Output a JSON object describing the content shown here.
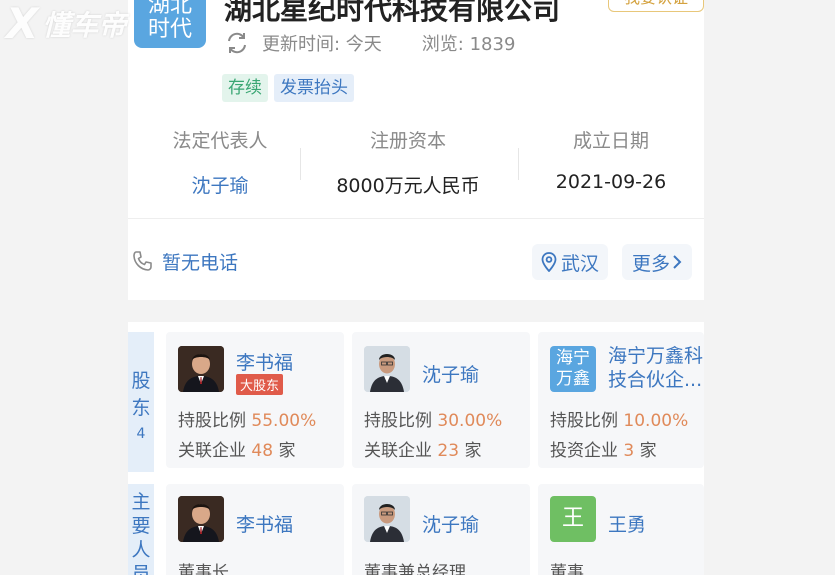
{
  "watermark": {
    "brand": "X",
    "text": "懂车帝"
  },
  "company": {
    "logo_text": [
      "湖北",
      "时代"
    ],
    "name": "湖北星纪时代科技有限公司",
    "claim_label": "我要认证",
    "updated": "更新时间: 今天",
    "views": "浏览: 1839",
    "tags": [
      "存续",
      "发票抬头"
    ]
  },
  "info": {
    "legal_rep_label": "法定代表人",
    "legal_rep_value": "沈子瑜",
    "capital_label": "注册资本",
    "capital_value": "8000万元人民币",
    "founded_label": "成立日期",
    "founded_value": "2021-09-26"
  },
  "contact": {
    "phone": "暂无电话",
    "city": "武汉",
    "more": "更多"
  },
  "shareholders": {
    "tab_label": [
      "股",
      "东"
    ],
    "count": "4",
    "items": [
      {
        "name": "李书福",
        "badge": "大股东",
        "ratio_label": "持股比例 ",
        "ratio": "55.00%",
        "rel_label": "关联企业 ",
        "rel_count": "48",
        "rel_unit": " 家"
      },
      {
        "name": "沈子瑜",
        "ratio_label": "持股比例 ",
        "ratio": "30.00%",
        "rel_label": "关联企业 ",
        "rel_count": "23",
        "rel_unit": " 家"
      },
      {
        "name_line1": "海宁万鑫科",
        "name_line2": "技合伙企...",
        "avatar_text": [
          "海宁",
          "万鑫"
        ],
        "ratio_label": "持股比例 ",
        "ratio": "10.00%",
        "rel_label": "投资企业 ",
        "rel_count": "3",
        "rel_unit": " 家"
      }
    ]
  },
  "staff": {
    "tab_label": [
      "主",
      "要",
      "人",
      "员"
    ],
    "items": [
      {
        "name": "李书福",
        "role": "董事长"
      },
      {
        "name": "沈子瑜",
        "role": "董事兼总经理"
      },
      {
        "name": "王勇",
        "avatar_text": "王",
        "role": "董事"
      }
    ]
  },
  "colors": {
    "link": "#3d77c0",
    "accent_orange": "#e08a5a",
    "badge_red": "#e05b4a"
  }
}
